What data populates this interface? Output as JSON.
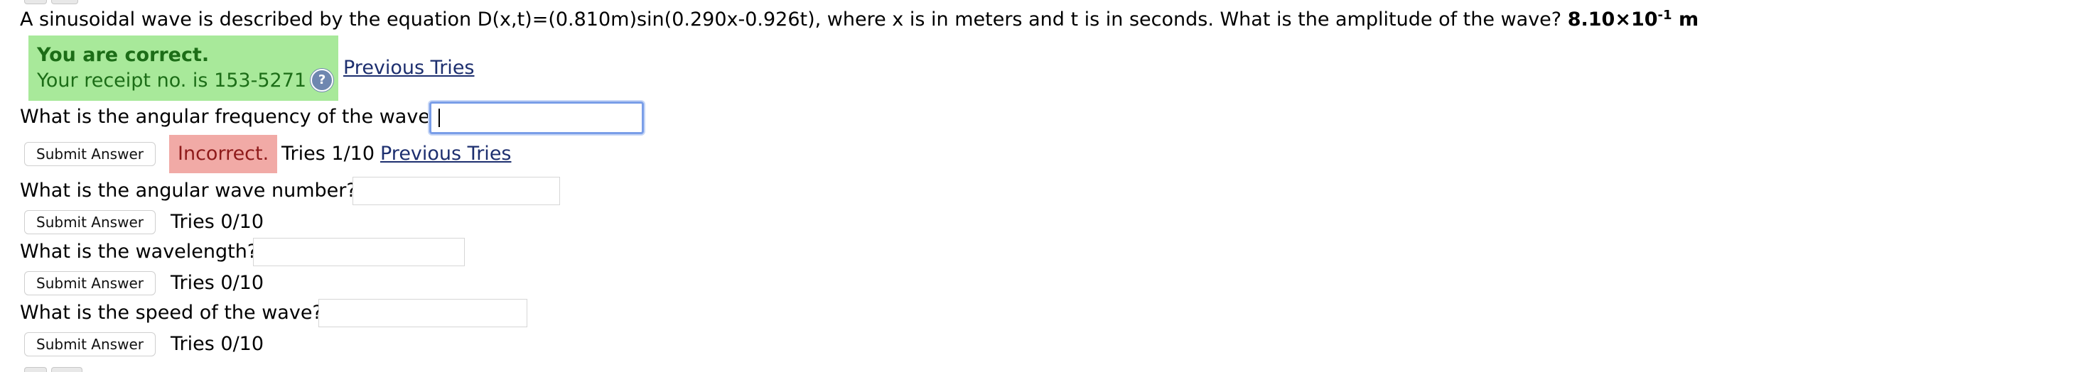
{
  "question": {
    "text": "A sinusoidal wave is described by the equation D(x,t)=(0.810m)sin(0.290x-0.926t), where x is in meters and t is in seconds. What is the amplitude of the wave?",
    "answer_mantissa": "8.10×10",
    "answer_exponent": "-1",
    "answer_unit": "m"
  },
  "feedback_correct": {
    "title": "You are correct.",
    "receipt": "Your receipt no. is 153-5271",
    "help_icon": "?",
    "previous_tries_label": "Previous Tries"
  },
  "parts": [
    {
      "label": "What is the angular frequency of the wave?",
      "input_value": "",
      "submit_label": "Submit Answer",
      "status": "Incorrect.",
      "tries": "Tries 1/10",
      "previous_tries_label": "Previous Tries"
    },
    {
      "label": "What is the angular wave number?",
      "input_value": "",
      "submit_label": "Submit Answer",
      "tries": "Tries 0/10"
    },
    {
      "label": "What is the wavelength?",
      "input_value": "",
      "submit_label": "Submit Answer",
      "tries": "Tries 0/10"
    },
    {
      "label": "What is the speed of the wave?",
      "input_value": "",
      "submit_label": "Submit Answer",
      "tries": "Tries 0/10"
    }
  ],
  "colors": {
    "correct_bg": "#a8e99a",
    "correct_text": "#1c6d17",
    "incorrect_bg": "#f1aaa6",
    "incorrect_text": "#8e1a1a",
    "link": "#1d2f6f",
    "focus_border": "#7a9ee8"
  }
}
